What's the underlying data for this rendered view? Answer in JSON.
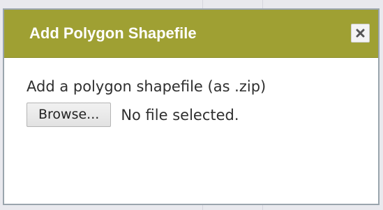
{
  "colors": {
    "titlebar": "#9fa033",
    "title_text": "#ffffff",
    "body_text": "#2f2f2f",
    "dialog_border": "#9aa5ad"
  },
  "dialog": {
    "title": "Add Polygon Shapefile",
    "close_icon": "close-icon",
    "prompt": "Add a polygon shapefile (as .zip)",
    "file_input": {
      "button_label": "Browse...",
      "status": "No file selected."
    }
  }
}
